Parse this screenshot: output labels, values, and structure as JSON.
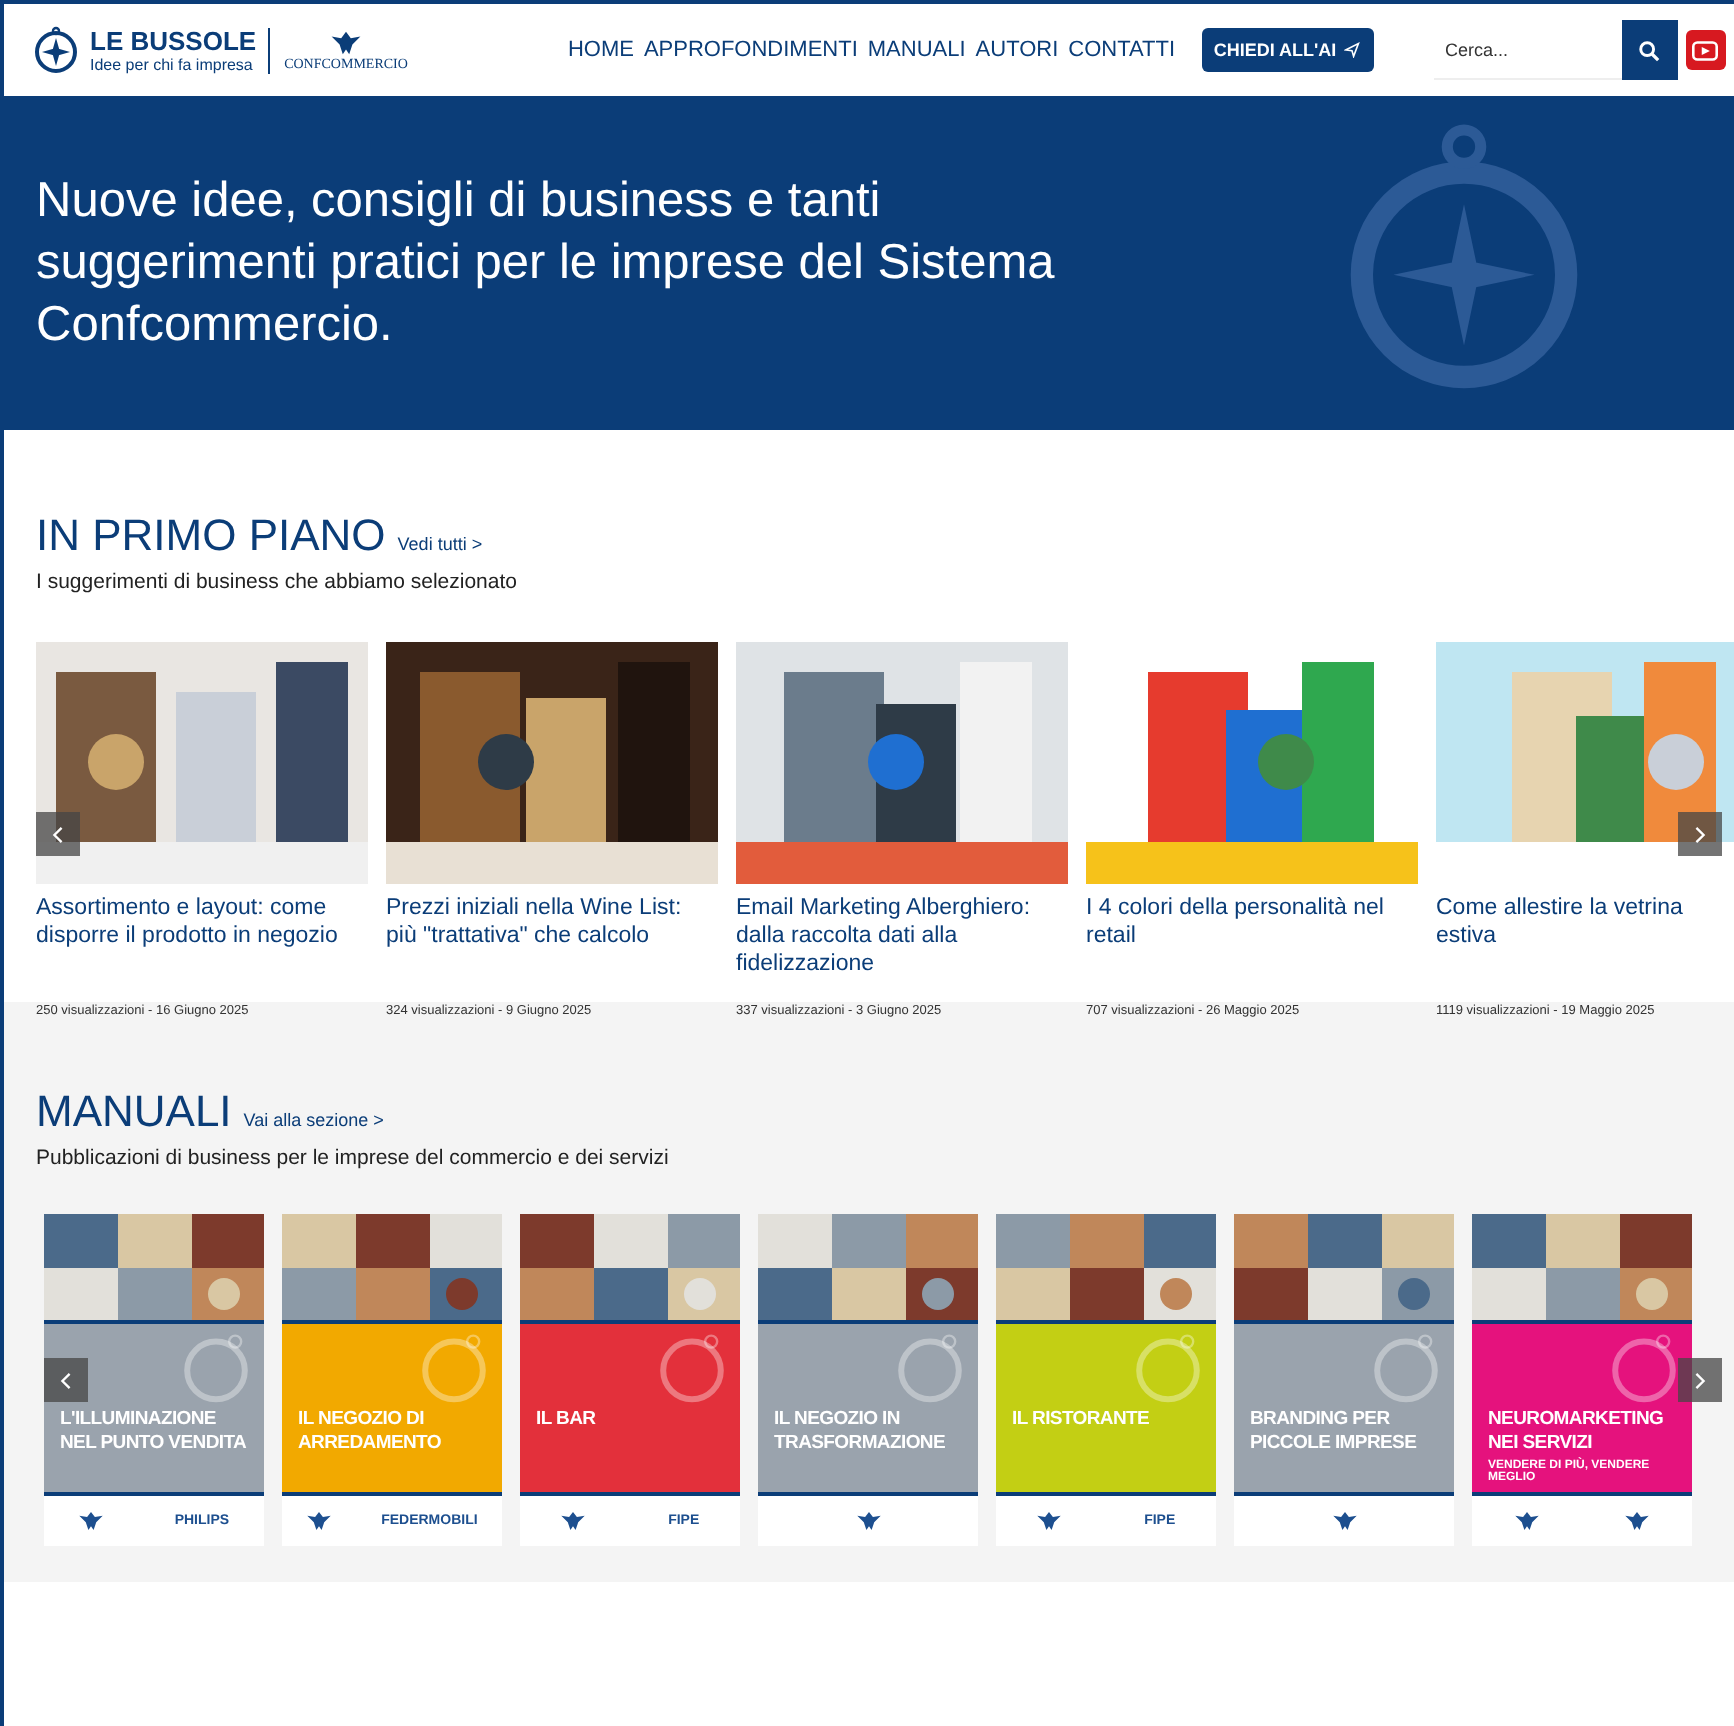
{
  "header": {
    "logo": {
      "title": "LE BUSSOLE",
      "tagline": "Idee per chi fa impresa",
      "partner": "CONFCOMMERCIO"
    },
    "nav": [
      {
        "label": "HOME"
      },
      {
        "label": "APPROFONDIMENTI"
      },
      {
        "label": "MANUALI"
      },
      {
        "label": "AUTORI"
      },
      {
        "label": "CONTATTI"
      }
    ],
    "ai_button": "CHIEDI ALL'AI",
    "search": {
      "placeholder": "Cerca..."
    }
  },
  "hero": {
    "text": "Nuove idee, consigli di business e tanti suggerimenti pratici per le imprese del Sistema Confcommercio."
  },
  "featured": {
    "title": "IN PRIMO PIANO",
    "link": "Vedi tutti >",
    "subtitle": "I suggerimenti di business che abbiamo selezionato",
    "articles": [
      {
        "title": "Assortimento e layout: come disporre il prodotto in negozio",
        "meta": "250 visualizzazioni - 16 Giugno 2025"
      },
      {
        "title": "Prezzi iniziali nella Wine List: più \"trattativa\" che calcolo",
        "meta": "324 visualizzazioni - 9 Giugno 2025"
      },
      {
        "title": "Email Marketing Alberghiero: dalla raccolta dati alla fidelizzazione",
        "meta": "337 visualizzazioni - 3 Giugno 2025"
      },
      {
        "title": "I 4 colori della personalità nel retail",
        "meta": "707 visualizzazioni - 26 Maggio 2025"
      },
      {
        "title": "Come allestire la vetrina estiva",
        "meta": "1119 visualizzazioni - 19 Maggio 2025"
      }
    ]
  },
  "manuals": {
    "title": "MANUALI",
    "link": "Vai alla sezione >",
    "subtitle": "Pubblicazioni di business per le imprese del commercio e dei servizi",
    "books": [
      {
        "title": "L'ILLUMINAZIONE NEL PUNTO VENDITA",
        "color": "#9aa3ad",
        "partners": [
          {
            "kind": "emblem"
          },
          {
            "kind": "wordmark",
            "text": "PHILIPS"
          }
        ]
      },
      {
        "title": "IL NEGOZIO DI ARREDAMENTO",
        "color": "#f2a900",
        "partners": [
          {
            "kind": "emblem"
          },
          {
            "kind": "wordmark",
            "text": "FEDERMOBILI"
          }
        ]
      },
      {
        "title": "IL BAR",
        "color": "#e3303b",
        "partners": [
          {
            "kind": "emblem"
          },
          {
            "kind": "wordmark",
            "text": "FIPE"
          }
        ]
      },
      {
        "title": "IL NEGOZIO IN TRASFORMAZIONE",
        "color": "#9aa3ad",
        "partners": [
          {
            "kind": "emblem"
          }
        ]
      },
      {
        "title": "IL RISTORANTE",
        "color": "#c3cf14",
        "partners": [
          {
            "kind": "emblem"
          },
          {
            "kind": "wordmark",
            "text": "FIPE"
          }
        ]
      },
      {
        "title": "BRANDING PER PICCOLE IMPRESE",
        "color": "#9aa3ad",
        "partners": [
          {
            "kind": "emblem"
          }
        ]
      },
      {
        "title": "NEUROMARKETING NEI SERVIZI",
        "subtitle": "VENDERE DI PIÙ, VENDERE MEGLIO",
        "color": "#e5127d",
        "partners": [
          {
            "kind": "emblem"
          },
          {
            "kind": "emblem"
          }
        ]
      }
    ]
  }
}
